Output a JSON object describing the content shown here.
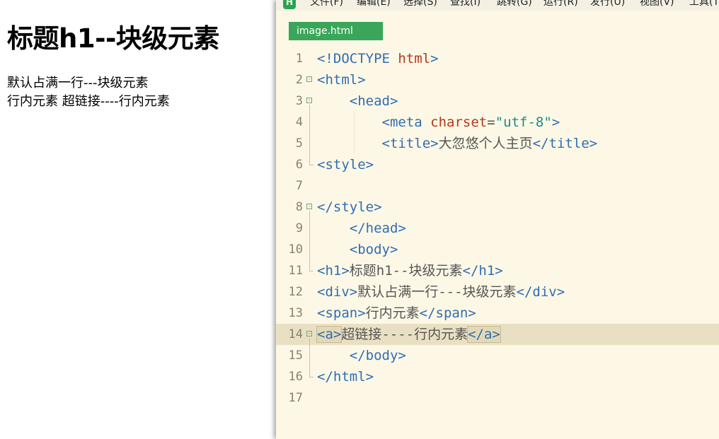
{
  "preview": {
    "h1_text": "标题h1--块级元素",
    "div_text": "默认占满一行---块级元素",
    "span_text": "行内元素",
    "link_text": "超链接----行内元素"
  },
  "editor": {
    "logo": "H",
    "menu": [
      "文件(F)",
      "编辑(E)",
      "选择(S)",
      "查找(I)",
      "跳转(G)",
      "运行(R)",
      "发行(U)",
      "视图(V)",
      "工具(T"
    ],
    "tab_label": "image.html",
    "lines": [
      {
        "num": "1",
        "fold": false,
        "indent": "",
        "html": "<span class=\"doctype\">&lt;!DOCTYPE</span> <span class=\"kw\">html</span><span class=\"tag\">&gt;</span>"
      },
      {
        "num": "2",
        "fold": true,
        "indent": "",
        "html": "<span class=\"tag\">&lt;html&gt;</span>"
      },
      {
        "num": "3",
        "fold": true,
        "indent": "    ",
        "html": "<span class=\"tag\">&lt;head&gt;</span>"
      },
      {
        "num": "4",
        "fold": false,
        "indent": "        ",
        "html": "<span class=\"tag\">&lt;meta</span> <span class=\"attr\">charset</span><span class=\"eq\">=</span><span class=\"str\">\"utf-8\"</span><span class=\"tag\">&gt;</span>"
      },
      {
        "num": "5",
        "fold": false,
        "indent": "        ",
        "html": "<span class=\"tag\">&lt;title&gt;</span><span class=\"txt\">大忽悠个人主页</span><span class=\"tag\">&lt;/title&gt;</span>"
      },
      {
        "num": "6",
        "fold": false,
        "indent": "",
        "html": "<span class=\"tag\">&lt;style&gt;</span>"
      },
      {
        "num": "7",
        "fold": false,
        "indent": "",
        "html": ""
      },
      {
        "num": "8",
        "fold": true,
        "indent": "",
        "html": "<span class=\"tag\">&lt;/style&gt;</span>"
      },
      {
        "num": "9",
        "fold": false,
        "indent": "    ",
        "html": "<span class=\"tag\">&lt;/head&gt;</span>"
      },
      {
        "num": "10",
        "fold": false,
        "indent": "    ",
        "html": "<span class=\"tag\">&lt;body&gt;</span>"
      },
      {
        "num": "11",
        "fold": false,
        "indent": "",
        "html": "<span class=\"tag\">&lt;h1&gt;</span><span class=\"txt\">标题h1--块级元素</span><span class=\"tag\">&lt;/h1&gt;</span>"
      },
      {
        "num": "12",
        "fold": false,
        "indent": "",
        "html": "<span class=\"tag\">&lt;div&gt;</span><span class=\"txt\">默认占满一行---块级元素</span><span class=\"tag\">&lt;/div&gt;</span>"
      },
      {
        "num": "13",
        "fold": false,
        "indent": "",
        "html": "<span class=\"tag\">&lt;span&gt;</span><span class=\"txt\">行内元素</span><span class=\"tag\">&lt;/span&gt;</span>"
      },
      {
        "num": "14",
        "fold": true,
        "indent": "",
        "html": "<span class=\"tag hl-box\">&lt;a&gt;</span><span class=\"txt\">超链接----行内元素</span><span class=\"tag hl-box\">&lt;/a&gt;</span>",
        "active": true
      },
      {
        "num": "15",
        "fold": false,
        "indent": "    ",
        "html": "<span class=\"tag\">&lt;/body&gt;</span>"
      },
      {
        "num": "16",
        "fold": false,
        "indent": "",
        "html": "<span class=\"tag\">&lt;/html&gt;</span>"
      },
      {
        "num": "17",
        "fold": false,
        "indent": "",
        "html": ""
      }
    ]
  }
}
